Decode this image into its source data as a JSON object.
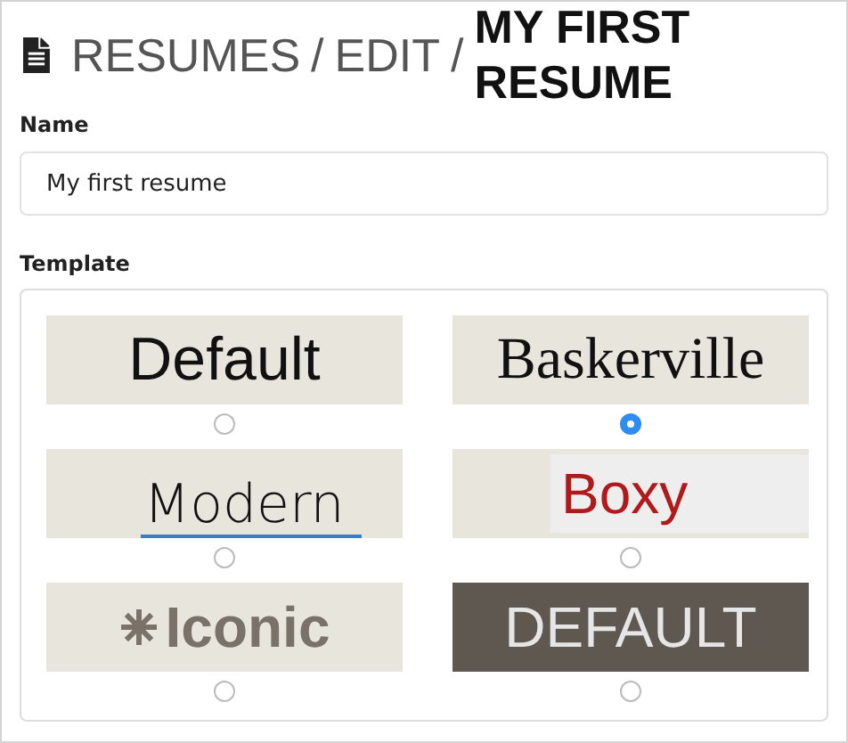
{
  "breadcrumb": {
    "parts": [
      "RESUMES",
      "EDIT"
    ],
    "current": "MY FIRST RESUME",
    "separator": "/"
  },
  "name_field": {
    "label": "Name",
    "value": "My first resume"
  },
  "template": {
    "label": "Template",
    "options": [
      {
        "kind": "default",
        "preview": "Default",
        "selected": false
      },
      {
        "kind": "baskerville",
        "preview": "Baskerville",
        "selected": true
      },
      {
        "kind": "modern",
        "preview": "Modern",
        "selected": false
      },
      {
        "kind": "boxy",
        "preview": "Boxy",
        "selected": false
      },
      {
        "kind": "iconic",
        "preview": "Iconic",
        "selected": false
      },
      {
        "kind": "dark",
        "preview": "DEFAULT",
        "selected": false
      }
    ]
  }
}
